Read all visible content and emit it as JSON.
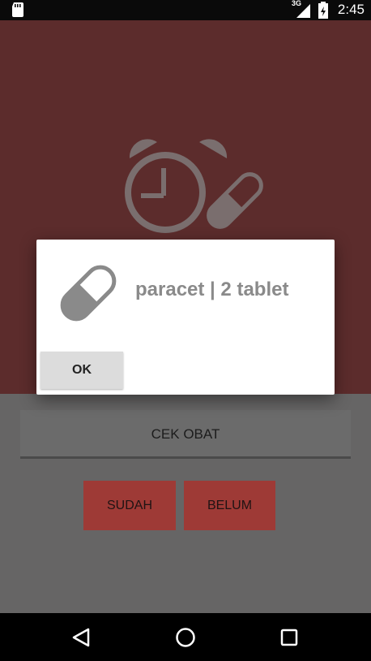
{
  "status_bar": {
    "network_label": "3G",
    "time": "2:45"
  },
  "main": {
    "cek_obat_label": "CEK OBAT",
    "sudah_label": "SUDAH",
    "belum_label": "BELUM"
  },
  "dialog": {
    "message": "paracet  |  2 tablet",
    "ok_label": "OK"
  },
  "nav": {
    "back": "back-icon",
    "home": "home-icon",
    "recents": "recents-icon"
  },
  "colors": {
    "header_bg": "#5c2c2c",
    "accent_button": "#9e3a36",
    "content_bg": "#666565",
    "dialog_text": "#8a8a8a"
  }
}
